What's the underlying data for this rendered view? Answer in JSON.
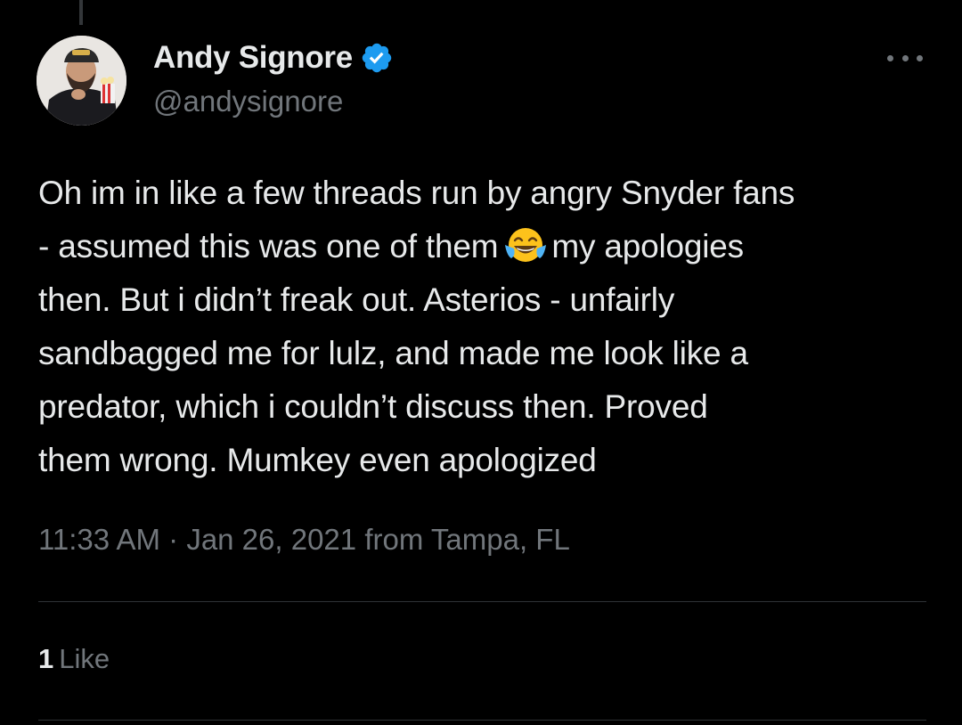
{
  "author": {
    "display_name": "Andy Signore",
    "handle": "@andysignore",
    "verified": true
  },
  "tweet": {
    "text_lines": [
      "Oh im in like a few threads run by angry Snyder fans",
      "- assumed this was one of them",
      "my apologies",
      "then. But i didn’t freak out. Asterios - unfairly",
      "sandbagged me for lulz, and made me look like a",
      "predator, which i couldn’t discuss then. Proved",
      "them wrong. Mumkey even apologized"
    ],
    "emoji": "face-with-tears-of-joy",
    "time": "11:33 AM",
    "separator": " · ",
    "date": "Jan 26, 2021",
    "source": " from Tampa, FL"
  },
  "stats": {
    "likes_count": "1",
    "likes_label": "Like"
  },
  "colors": {
    "background": "#000000",
    "text": "#e7e9ea",
    "secondary": "#71767b",
    "verified": "#1d9bf0",
    "divider": "#2f3336"
  }
}
